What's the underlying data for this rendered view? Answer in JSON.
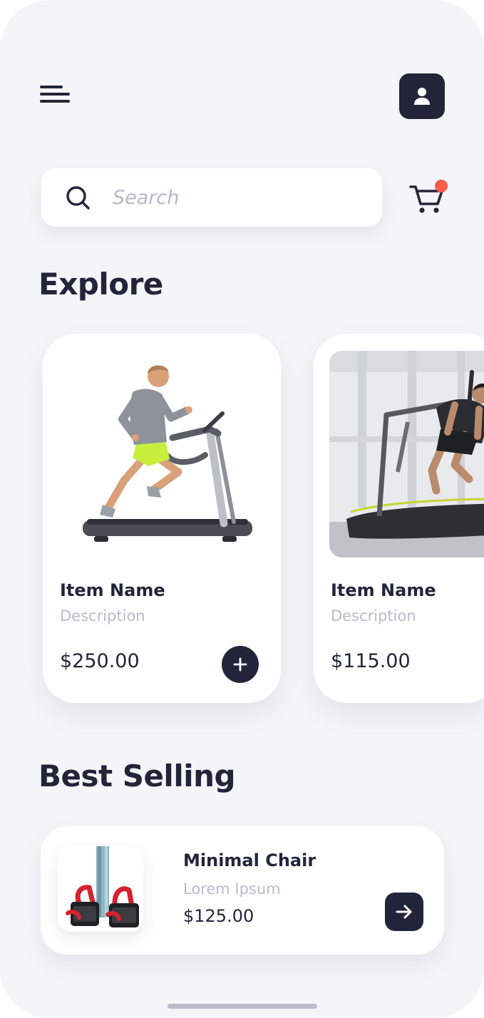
{
  "search": {
    "placeholder": "Search"
  },
  "colors": {
    "accent": "#22253a",
    "badge": "#fb5b4a",
    "background": "#f4f5f9",
    "muted": "#b8bacd"
  },
  "icons": {
    "menu": "menu-icon",
    "profile": "user-icon",
    "search": "search-icon",
    "cart": "cart-icon",
    "add": "plus-icon",
    "go": "arrow-right-icon"
  },
  "explore": {
    "title": "Explore",
    "items": [
      {
        "name": "Item Name",
        "description": "Description",
        "price": "$250.00"
      },
      {
        "name": "Item Name",
        "description": "Description",
        "price": "$115.00"
      }
    ]
  },
  "best_selling": {
    "title": "Best Selling",
    "item": {
      "name": "Minimal Chair",
      "description": "Lorem Ipsum",
      "price": "$125.00"
    }
  }
}
